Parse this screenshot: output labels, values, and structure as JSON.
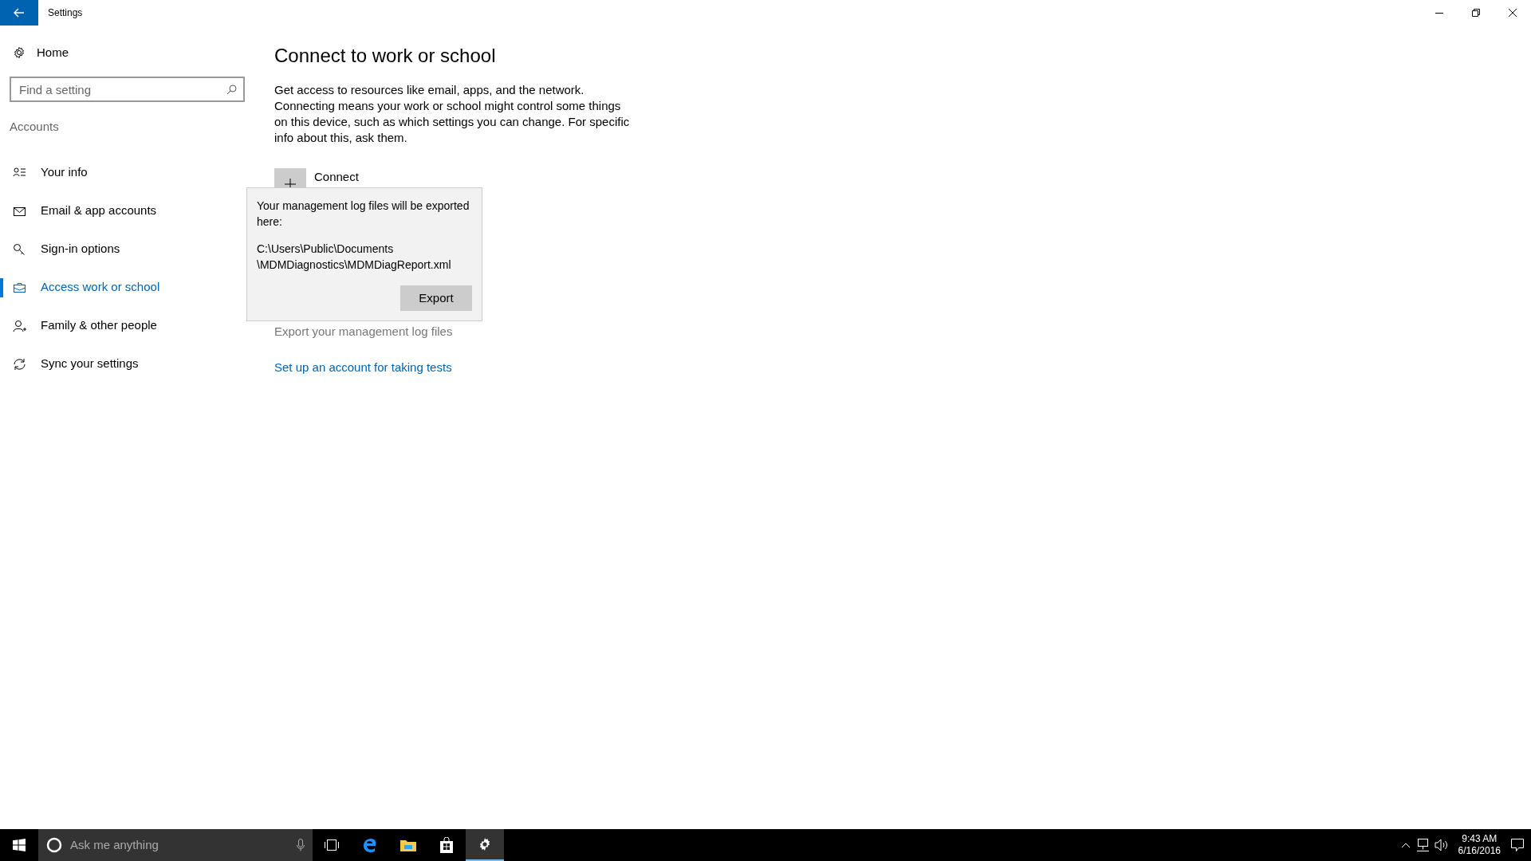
{
  "window": {
    "title": "Settings"
  },
  "sidebar": {
    "home": "Home",
    "search": {
      "placeholder": "Find a setting"
    },
    "section": "Accounts",
    "items": [
      {
        "label": "Your info",
        "selected": false
      },
      {
        "label": "Email & app accounts",
        "selected": false
      },
      {
        "label": "Sign-in options",
        "selected": false
      },
      {
        "label": "Access work or school",
        "selected": true
      },
      {
        "label": "Family & other people",
        "selected": false
      },
      {
        "label": "Sync your settings",
        "selected": false
      }
    ]
  },
  "main": {
    "title": "Connect to work or school",
    "description": "Get access to resources like email, apps, and the network. Connecting means your work or school might control some things on this device, such as which settings you can change. For specific info about this, ask them.",
    "connect": "Connect",
    "flyout": {
      "message": "Your management log files will be exported here:",
      "path_lines": [
        "C:\\Users\\Public\\Documents",
        "\\MDMDiagnostics\\MDMDiagReport.xml"
      ],
      "button": "Export"
    },
    "export_link": "Export your management log files",
    "test_link": "Set up an account for taking tests"
  },
  "taskbar": {
    "search": {
      "placeholder": "Ask me anything"
    },
    "apps": [
      {
        "selected": false
      },
      {
        "selected": false
      },
      {
        "selected": false
      },
      {
        "selected": false
      },
      {
        "selected": true
      }
    ],
    "time": "9:43 AM",
    "date": "6/16/2016"
  }
}
